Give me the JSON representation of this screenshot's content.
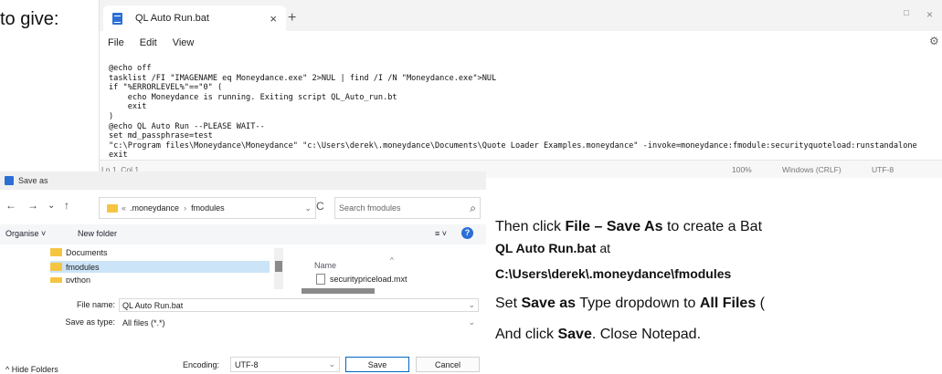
{
  "doc": {
    "intro": "to give:",
    "p1_a": "Then click ",
    "p1_b": "File – Save As",
    "p1_c": " to create a Bat",
    "p2": "QL Auto Run.bat",
    "p2_b": " at",
    "p3": "C:\\Users\\derek\\.moneydance\\fmodules",
    "p4_a": "Set ",
    "p4_b": "Save as",
    "p4_c": " Type dropdown to ",
    "p4_d": "All Files",
    "p4_e": " (",
    "p5_a": "And click ",
    "p5_b": "Save",
    "p5_c": ". Close Notepad."
  },
  "notepad": {
    "tab_title": "QL Auto Run.bat",
    "close_glyph": "×",
    "plus_glyph": "+",
    "min_glyph": "□",
    "close_win_glyph": "×",
    "gear_glyph": "⚙",
    "menu": [
      "File",
      "Edit",
      "View"
    ],
    "code": "@echo off\ntasklist /FI \"IMAGENAME eq Moneydance.exe\" 2>NUL | find /I /N \"Moneydance.exe\">NUL\nif \"%ERRORLEVEL%\"==\"0\" (\n    echo Moneydance is running. Exiting script QL_Auto_run.bt\n    exit\n)\n@echo QL Auto Run --PLEASE WAIT--\nset md_passphrase=test\n\"c:\\Program files\\Moneydance\\Moneydance\" \"c:\\Users\\derek\\.moneydance\\Documents\\Quote Loader Examples.moneydance\" -invoke=moneydance:fmodule:securityquoteload:runstandalone\nexit",
    "status": {
      "position": "Ln 1, Col 1",
      "zoom": "100%",
      "line_ending": "Windows (CRLF)",
      "encoding": "UTF-8"
    }
  },
  "dialog": {
    "title": "Save as",
    "nav": {
      "back": "←",
      "forward": "→",
      "recent": "⌄",
      "up": "↑",
      "refresh": "C"
    },
    "address": {
      "prefix": "«",
      "part1": ".moneydance",
      "sep": "›",
      "part2": "fmodules",
      "chevron": "⌄"
    },
    "search_placeholder": "Search fmodules",
    "search_glyph": "⌕",
    "toolbar": {
      "organise": "Organise ˅",
      "new_folder": "New folder",
      "view_glyph": "≡ ˅",
      "help": "?"
    },
    "tree": [
      {
        "label": "Documents",
        "selected": false
      },
      {
        "label": "fmodules",
        "selected": true
      },
      {
        "label": "python",
        "selected": false
      }
    ],
    "column_name": "Name",
    "sort_glyph": "^",
    "files": [
      "securitypriceload.mxt"
    ],
    "file_name_label": "File name:",
    "file_name_value": "QL Auto Run.bat",
    "type_label": "Save as type:",
    "type_value": "All files  (*.*)",
    "dropdown_glyph": "⌄",
    "hide_folders": "^ Hide Folders",
    "encoding_label": "Encoding:",
    "encoding_value": "UTF-8",
    "save_label": "Save",
    "cancel_label": "Cancel"
  }
}
